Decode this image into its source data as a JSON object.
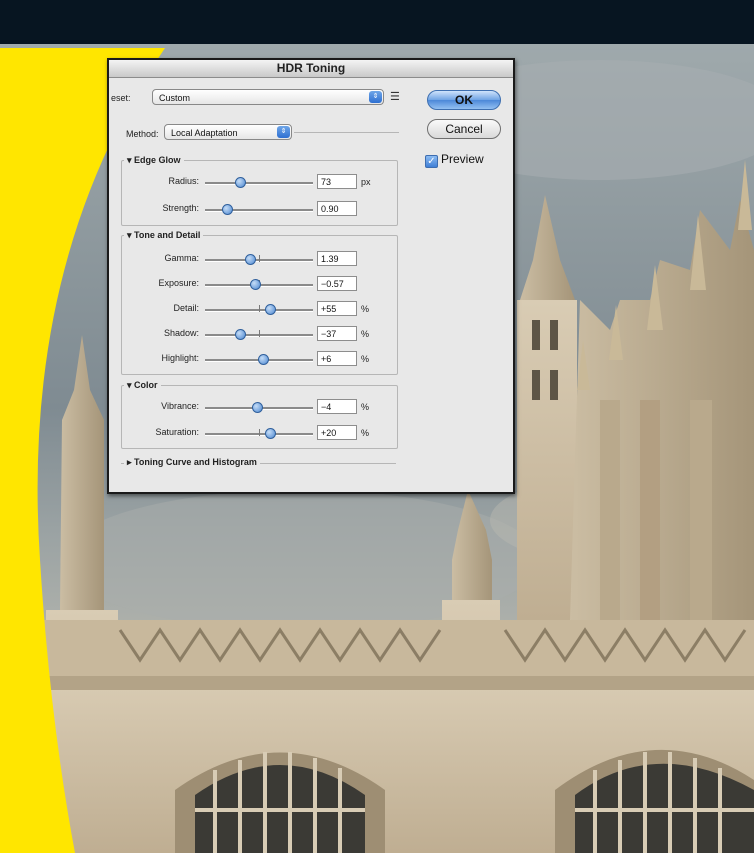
{
  "dialog": {
    "title": "HDR Toning",
    "preset_label": "eset:",
    "preset_value": "Custom",
    "method_label": "Method:",
    "method_value": "Local Adaptation",
    "ok": "OK",
    "cancel": "Cancel",
    "preview": "Preview",
    "preview_checked": true,
    "edge_glow": {
      "title": "Edge Glow",
      "radius": {
        "label": "Radius:",
        "value": "73",
        "unit": "px",
        "level": 0.32
      },
      "strength": {
        "label": "Strength:",
        "value": "0.90",
        "unit": "",
        "level": 0.2
      }
    },
    "tone_detail": {
      "title": "Tone and Detail",
      "gamma": {
        "label": "Gamma:",
        "value": "1.39",
        "unit": "",
        "level": 0.42
      },
      "exposure": {
        "label": "Exposure:",
        "value": "−0.57",
        "unit": "",
        "level": 0.46
      },
      "detail": {
        "label": "Detail:",
        "value": "+55",
        "unit": "%",
        "level": 0.6
      },
      "shadow": {
        "label": "Shadow:",
        "value": "−37",
        "unit": "%",
        "level": 0.32
      },
      "highlight": {
        "label": "Highlight:",
        "value": "+6",
        "unit": "%",
        "level": 0.54
      }
    },
    "color": {
      "title": "Color",
      "vibrance": {
        "label": "Vibrance:",
        "value": "−4",
        "unit": "%",
        "level": 0.48
      },
      "saturation": {
        "label": "Saturation:",
        "value": "+20",
        "unit": "%",
        "level": 0.6
      }
    },
    "curve_section": "Toning Curve and Histogram"
  },
  "colors": {
    "yellow": "#ffe600",
    "top_band": "#071521",
    "ok_blue": "#4c88d8"
  }
}
